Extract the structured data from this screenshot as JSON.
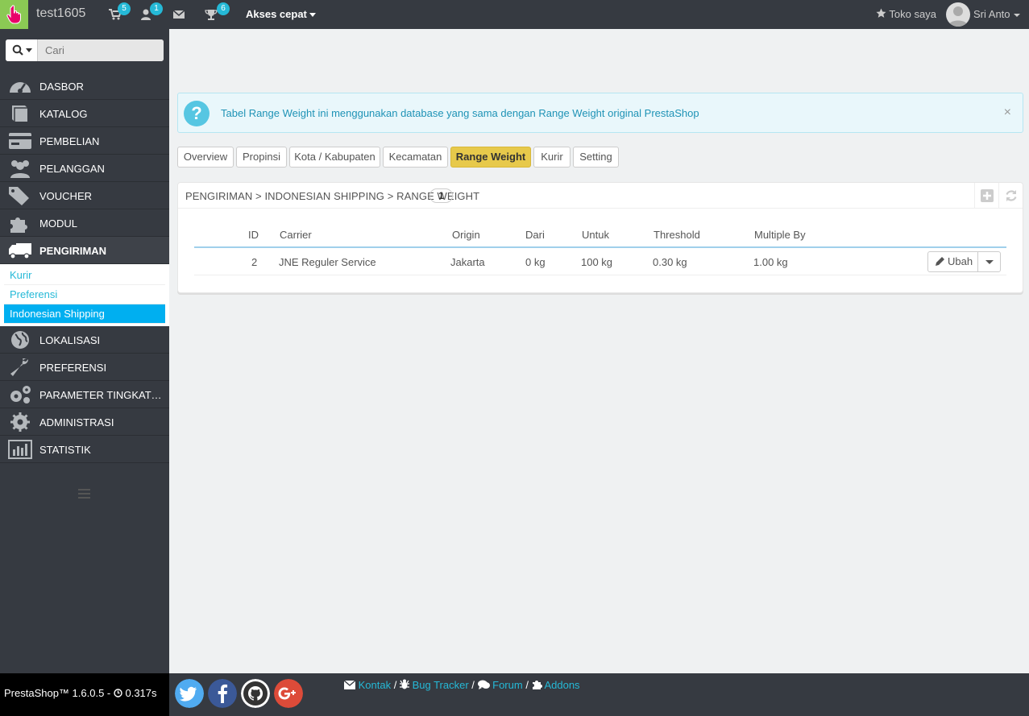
{
  "header": {
    "shop_name": "test1605",
    "orders_count": "5",
    "customers_count": "1",
    "trophy_count": "6",
    "quick_access": "Akses cepat",
    "my_shop": "Toko saya",
    "user_name": "Sri Anto"
  },
  "sidebar": {
    "search_placeholder": "Cari",
    "items": [
      {
        "label": "DASBOR",
        "icon": "dashboard-icon"
      },
      {
        "label": "KATALOG",
        "icon": "book-icon"
      },
      {
        "label": "PEMBELIAN",
        "icon": "credit-card-icon"
      },
      {
        "label": "PELANGGAN",
        "icon": "users-icon"
      },
      {
        "label": "VOUCHER",
        "icon": "tags-icon"
      },
      {
        "label": "MODUL",
        "icon": "puzzle-icon"
      },
      {
        "label": "PENGIRIMAN",
        "icon": "truck-icon"
      },
      {
        "label": "LOKALISASI",
        "icon": "globe-icon"
      },
      {
        "label": "PREFERENSI",
        "icon": "wrench-icon"
      },
      {
        "label": "PARAMETER TINGKAT LANJUT",
        "icon": "cogs-icon"
      },
      {
        "label": "ADMINISTRASI",
        "icon": "cog-icon"
      },
      {
        "label": "STATISTIK",
        "icon": "bar-chart-icon"
      }
    ],
    "submenu": [
      {
        "label": "Kurir"
      },
      {
        "label": "Preferensi"
      },
      {
        "label": "Indonesian Shipping"
      }
    ]
  },
  "alert": {
    "text": "Tabel Range Weight ini menggunakan database yang sama dengan Range Weight original PrestaShop",
    "close": "×"
  },
  "tabs": [
    {
      "label": "Overview"
    },
    {
      "label": "Propinsi"
    },
    {
      "label": "Kota / Kabupaten"
    },
    {
      "label": "Kecamatan"
    },
    {
      "label": "Range Weight"
    },
    {
      "label": "Kurir"
    },
    {
      "label": "Setting"
    }
  ],
  "panel": {
    "title": "PENGIRIMAN > INDONESIAN SHIPPING > RANGE WEIGHT",
    "count": "1",
    "columns": [
      "ID",
      "Carrier",
      "Origin",
      "Dari",
      "Untuk",
      "Threshold",
      "Multiple By"
    ],
    "rows": [
      {
        "id": "2",
        "carrier": "JNE Reguler Service",
        "origin": "Jakarta",
        "dari": "0 kg",
        "untuk": "100 kg",
        "threshold": "0.30 kg",
        "multiple_by": "1.00 kg"
      }
    ],
    "edit_label": "Ubah"
  },
  "footer": {
    "version": "PrestaShop™ 1.6.0.5 - ",
    "load_time": "0.317s",
    "links": [
      {
        "label": "Kontak"
      },
      {
        "label": "Bug Tracker"
      },
      {
        "label": "Forum"
      },
      {
        "label": "Addons"
      }
    ]
  },
  "colors": {
    "header_bg": "#363a41",
    "accent": "#25b9d7",
    "active_tab": "#e7c94b",
    "logo_green": "#8bc954"
  }
}
